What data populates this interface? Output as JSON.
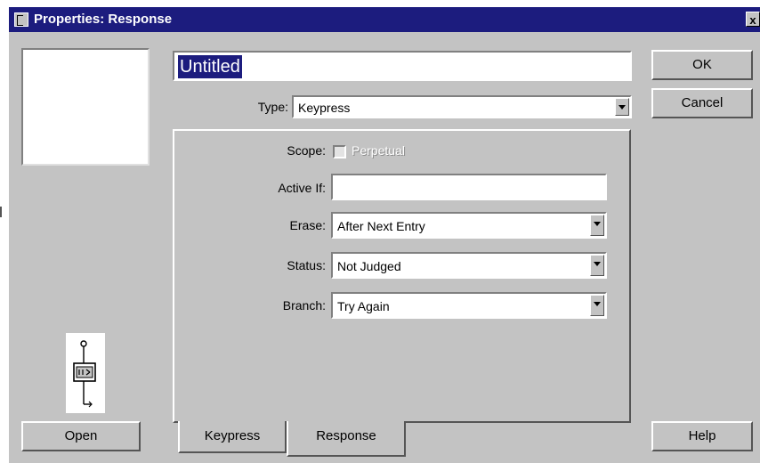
{
  "window": {
    "title": "Properties: Response",
    "close_label": "x"
  },
  "name_field": {
    "value": "Untitled"
  },
  "type": {
    "label": "Type:",
    "value": "Keypress"
  },
  "scope": {
    "label": "Scope:",
    "checkbox_label": "Perpetual",
    "checked": false
  },
  "active_if": {
    "label": "Active If:",
    "value": ""
  },
  "erase": {
    "label": "Erase:",
    "value": "After Next Entry"
  },
  "status": {
    "label": "Status:",
    "value": "Not Judged"
  },
  "branch": {
    "label": "Branch:",
    "value": "Try Again"
  },
  "tabs": [
    {
      "label": "Keypress",
      "active": false
    },
    {
      "label": "Response",
      "active": true
    }
  ],
  "buttons": {
    "ok": "OK",
    "cancel": "Cancel",
    "help": "Help",
    "open": "Open"
  },
  "icons": {
    "window": "authorware-window-icon",
    "preview": "response-flow-icon"
  }
}
